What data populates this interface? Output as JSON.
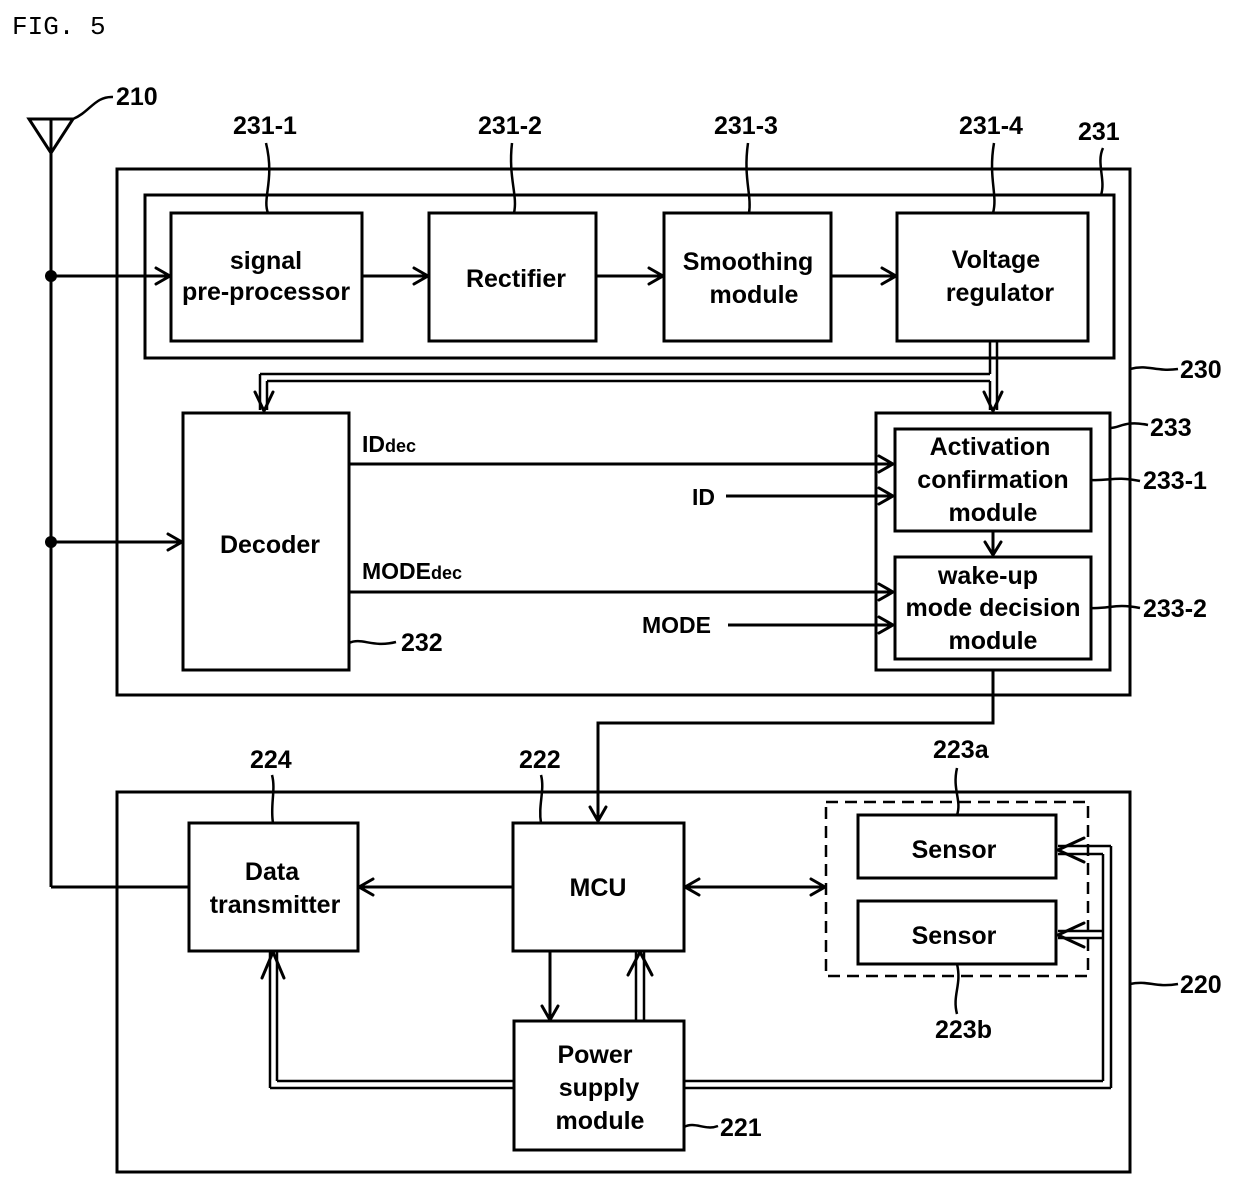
{
  "figure": {
    "title": "FIG. 5"
  },
  "antenna": {
    "ref": "210"
  },
  "wakeup_receiver": {
    "ref": "230",
    "power_chain": {
      "ref": "231",
      "blocks": [
        {
          "ref": "231-1",
          "lines": [
            "signal",
            "pre-processor"
          ]
        },
        {
          "ref": "231-2",
          "lines": [
            "Rectifier"
          ]
        },
        {
          "ref": "231-3",
          "lines": [
            "Smoothing",
            "module"
          ]
        },
        {
          "ref": "231-4",
          "lines": [
            "Voltage",
            "regulator"
          ]
        }
      ]
    },
    "decoder": {
      "ref": "232",
      "label": "Decoder"
    },
    "controller": {
      "ref": "233",
      "activation": {
        "ref": "233-1",
        "lines": [
          "Activation",
          "confirmation",
          "module"
        ]
      },
      "mode_decision": {
        "ref": "233-2",
        "lines": [
          "wake-up",
          "mode decision",
          "module"
        ]
      }
    },
    "signals": {
      "id_dec_main": "ID",
      "id_dec_sub": "dec",
      "mode_dec_main": "MODE",
      "mode_dec_sub": "dec",
      "id": "ID",
      "mode": "MODE"
    }
  },
  "sensor_node": {
    "ref": "220",
    "power_supply": {
      "ref": "221",
      "lines": [
        "Power",
        "supply",
        "module"
      ]
    },
    "mcu": {
      "ref": "222",
      "label": "MCU"
    },
    "sensors": [
      {
        "ref": "223a",
        "label": "Sensor"
      },
      {
        "ref": "223b",
        "label": "Sensor"
      }
    ],
    "data_transmitter": {
      "ref": "224",
      "lines": [
        "Data",
        "transmitter"
      ]
    }
  }
}
